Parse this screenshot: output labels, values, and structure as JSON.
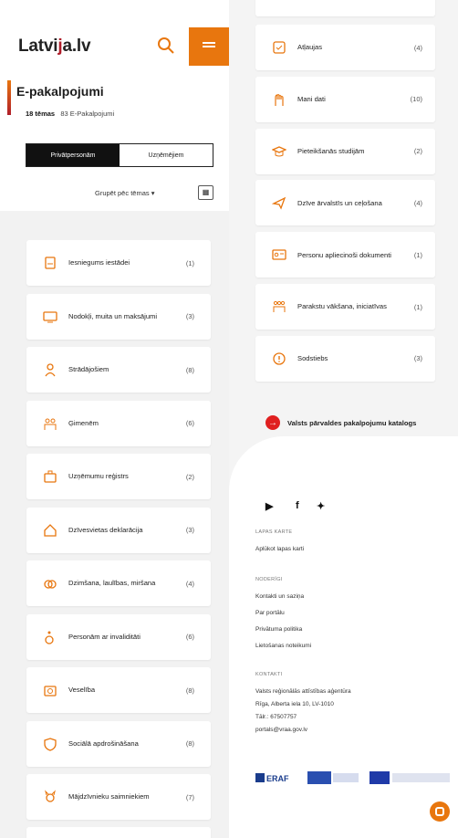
{
  "header": {
    "logo": "Latvija.lv"
  },
  "page": {
    "title": "E-pakalpojumi",
    "themes_count": "18 tēmas",
    "services_count": "83 E-Pakalpojumi"
  },
  "tabs": [
    "Privātpersonām",
    "Uzņēmējiem"
  ],
  "group_by": "Grupēt pēc tēmas",
  "left_items": [
    {
      "label": "Iesniegums iestādei",
      "count": "(1)",
      "icon": "document-icon"
    },
    {
      "label": "Nodokļi, muita un maksājumi",
      "count": "(3)",
      "icon": "monitor-icon"
    },
    {
      "label": "Strādājošiem",
      "count": "(8)",
      "icon": "worker-icon"
    },
    {
      "label": "Ģimenēm",
      "count": "(6)",
      "icon": "family-icon"
    },
    {
      "label": "Uzņēmumu reģistrs",
      "count": "(2)",
      "icon": "briefcase-icon"
    },
    {
      "label": "Dzīvesvietas deklarācija",
      "count": "(3)",
      "icon": "house-icon"
    },
    {
      "label": "Dzimšana, laulības, miršana",
      "count": "(4)",
      "icon": "rings-icon"
    },
    {
      "label": "Personām ar invaliditāti",
      "count": "(6)",
      "icon": "wheelchair-icon"
    },
    {
      "label": "Veselība",
      "count": "(8)",
      "icon": "health-icon"
    },
    {
      "label": "Sociālā apdrošināšana",
      "count": "(8)",
      "icon": "shield-icon"
    },
    {
      "label": "Mājdzīvnieku saimniekiem",
      "count": "(7)",
      "icon": "pet-icon"
    }
  ],
  "right_items": [
    {
      "label": "Atļaujas",
      "count": "(4)",
      "icon": "permit-icon"
    },
    {
      "label": "Mani dati",
      "count": "(10)",
      "icon": "hand-icon"
    },
    {
      "label": "Pieteikšanās studijām",
      "count": "(2)",
      "icon": "graduation-icon"
    },
    {
      "label": "Dzīve ārvalstīs un ceļošana",
      "count": "(4)",
      "icon": "plane-icon"
    },
    {
      "label": "Personu apliecinoši dokumenti",
      "count": "(1)",
      "icon": "id-card-icon"
    },
    {
      "label": "Parakstu vākšana, iniciatīvas",
      "count": "(1)",
      "icon": "people-icon"
    },
    {
      "label": "Sodstiebs",
      "count": "(3)",
      "icon": "alert-icon"
    }
  ],
  "catalog_link": "Valsts pārvaldes pakalpojumu katalogs",
  "footer": {
    "social": [
      "youtube-icon",
      "facebook-icon",
      "twitter-icon"
    ],
    "site_map_head": "LAPAS KARTE",
    "site_map_link": "Aplūkot lapas karti",
    "noderigi_head": "NODERĪGI",
    "noderigi_links": [
      "Kontakti un saziņa",
      "Par portālu",
      "Privātuma politika",
      "Lietošanas noteikumi"
    ],
    "kontakti_head": "KONTAKTI",
    "kontakti_lines": [
      "Valsts reģionālās attīstības aģentūra",
      "Rīga, Alberta iela 10, LV-1010",
      "Tālr.: 67507757",
      "portals@vraa.gov.lv"
    ]
  },
  "colors": {
    "accent": "#e8760e",
    "brand_red": "#b01e2a",
    "link_red": "#e02020"
  }
}
